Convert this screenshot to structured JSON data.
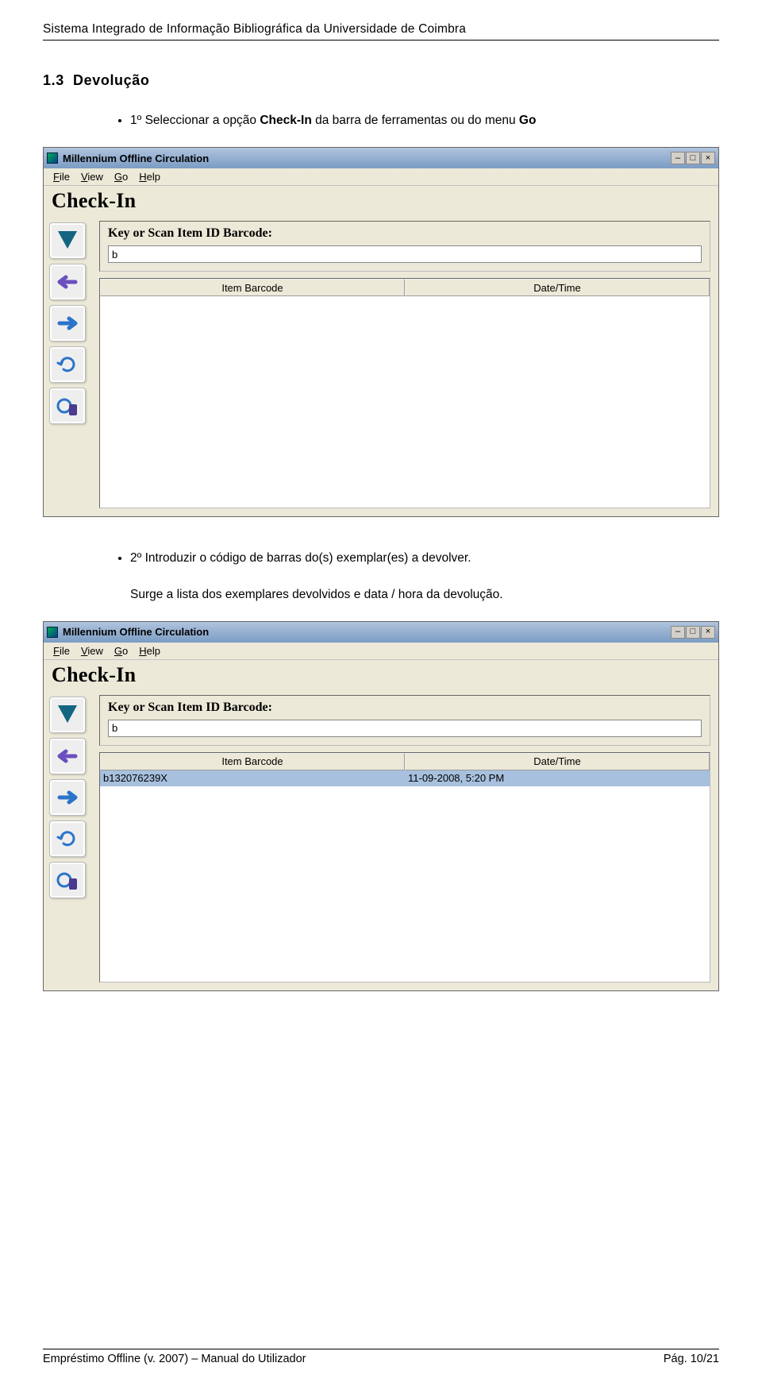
{
  "header": "Sistema Integrado de Informação Bibliográfica da Universidade de Coimbra",
  "section_number": "1.3",
  "section_title": "Devolução",
  "bullet1_pre": "1º  Seleccionar a opção ",
  "bullet1_bold": "Check-In",
  "bullet1_post": " da barra de ferramentas ou do menu ",
  "bullet1_bold2": "Go",
  "bullet2": "2º  Introduzir o código de barras do(s) exemplar(es) a devolver.",
  "bullet3": "Surge a lista dos exemplares devolvidos e data / hora da devolução.",
  "win": {
    "title": "Millennium Offline Circulation",
    "minimize": "–",
    "maximize": "□",
    "close": "×",
    "menu": {
      "file": "File",
      "view": "View",
      "go": "Go",
      "help": "Help"
    },
    "heading": "Check-In",
    "field_label": "Key or Scan Item ID Barcode:",
    "field_value": "b",
    "col_barcode": "Item Barcode",
    "col_datetime": "Date/Time"
  },
  "row": {
    "barcode": "b132076239X",
    "datetime": "11-09-2008, 5:20 PM"
  },
  "footer_left": "Empréstimo Offline (v. 2007) – Manual do Utilizador",
  "footer_right": "Pág. 10/21"
}
